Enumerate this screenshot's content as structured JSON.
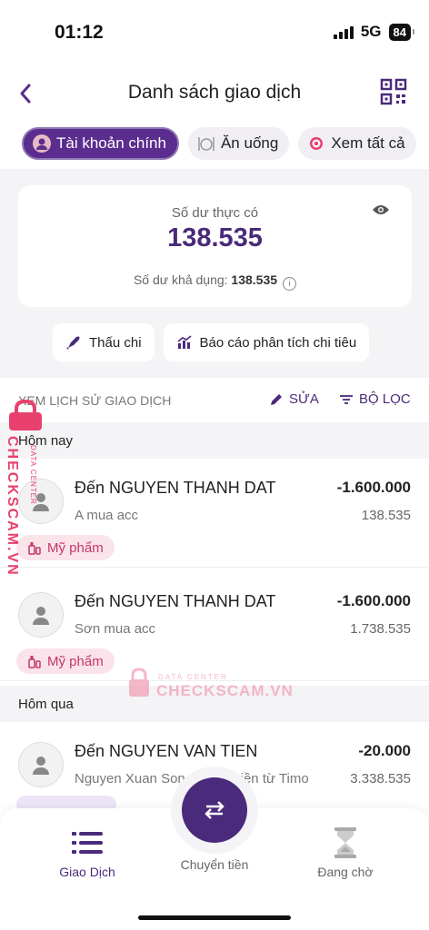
{
  "status": {
    "time": "01:12",
    "network": "5G",
    "battery": "84"
  },
  "header": {
    "title": "Danh sách giao dịch"
  },
  "chips": [
    {
      "label": "Tài khoản chính",
      "icon": "account-avatar-icon",
      "active": true
    },
    {
      "label": "Ăn uống",
      "icon": "dining-icon",
      "active": false
    },
    {
      "label": "Xem tất cả",
      "icon": "target-icon",
      "active": false
    }
  ],
  "balance": {
    "label": "Số dư thực có",
    "amount": "138.535",
    "available_label": "Số dư khả dụng:",
    "available_value": "138.535"
  },
  "actions": {
    "overdraft": "Thấu chi",
    "report": "Báo cáo phân tích chi tiêu"
  },
  "history": {
    "label": "XEM LỊCH SỬ GIAO DỊCH",
    "edit": "SỬA",
    "filter": "BỘ LỌC"
  },
  "groups": [
    {
      "day": "Hôm nay",
      "transactions": [
        {
          "name": "Đến NGUYEN THANH DAT",
          "note": "A mua acc",
          "amount": "-1.600.000",
          "balance": "138.535",
          "tag": "Mỹ phẩm"
        },
        {
          "name": "Đến NGUYEN THANH DAT",
          "note": "Sơn mua acc",
          "amount": "-1.600.000",
          "balance": "1.738.535",
          "tag": "Mỹ phẩm"
        }
      ]
    },
    {
      "day": "Hôm qua",
      "transactions": [
        {
          "name": "Đến NGUYEN VAN TIEN",
          "note": "Nguyen Xuan Son chuyển tiền từ Timo",
          "amount": "-20.000",
          "balance": "3.338.535",
          "tag": ""
        }
      ]
    }
  ],
  "watermark": {
    "brand": "CHECKSCAM.VN",
    "sub": "DATA CENTER"
  },
  "nav": {
    "transactions": "Giao Dịch",
    "transfer": "Chuyển tiền",
    "pending": "Đang chờ"
  },
  "colors": {
    "primary": "#4a2a7a",
    "tag_bg": "#fbe3ea",
    "tag_text": "#c2386a",
    "watermark": "#e8416d"
  }
}
